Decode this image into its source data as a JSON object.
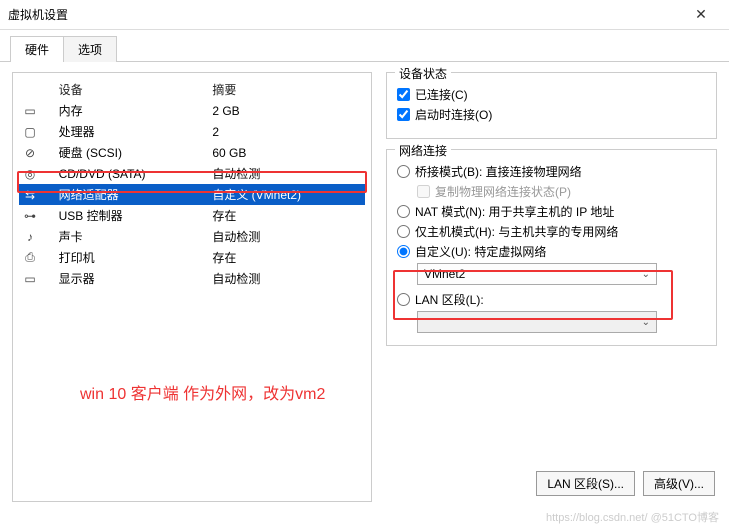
{
  "window": {
    "title": "虚拟机设置"
  },
  "tabs": {
    "hardware": "硬件",
    "options": "选项"
  },
  "columns": {
    "device": "设备",
    "summary": "摘要"
  },
  "hw": [
    {
      "icon": "▭",
      "name": "内存",
      "sum": "2 GB"
    },
    {
      "icon": "▢",
      "name": "处理器",
      "sum": "2"
    },
    {
      "icon": "⊘",
      "name": "硬盘 (SCSI)",
      "sum": "60 GB"
    },
    {
      "icon": "◎",
      "name": "CD/DVD (SATA)",
      "sum": "自动检测"
    },
    {
      "icon": "⇆",
      "name": "网络适配器",
      "sum": "自定义 (VMnet2)"
    },
    {
      "icon": "⊶",
      "name": "USB 控制器",
      "sum": "存在"
    },
    {
      "icon": "♪",
      "name": "声卡",
      "sum": "自动检测"
    },
    {
      "icon": "⎙",
      "name": "打印机",
      "sum": "存在"
    },
    {
      "icon": "▭",
      "name": "显示器",
      "sum": "自动检测"
    }
  ],
  "status": {
    "legend": "设备状态",
    "connected": "已连接(C)",
    "connect_poweron": "启动时连接(O)"
  },
  "net": {
    "legend": "网络连接",
    "bridged": "桥接模式(B): 直接连接物理网络",
    "replicate": "复制物理网络连接状态(P)",
    "nat": "NAT 模式(N): 用于共享主机的 IP 地址",
    "hostonly": "仅主机模式(H): 与主机共享的专用网络",
    "custom": "自定义(U): 特定虚拟网络",
    "custom_value": "VMnet2",
    "lan": "LAN 区段(L):",
    "lan_value": ""
  },
  "buttons": {
    "lanseg": "LAN 区段(S)...",
    "advanced": "高级(V)..."
  },
  "annotation": "win 10 客户端 作为外网，改为vm2",
  "watermark": "https://blog.csdn.net/   @51CTO博客"
}
